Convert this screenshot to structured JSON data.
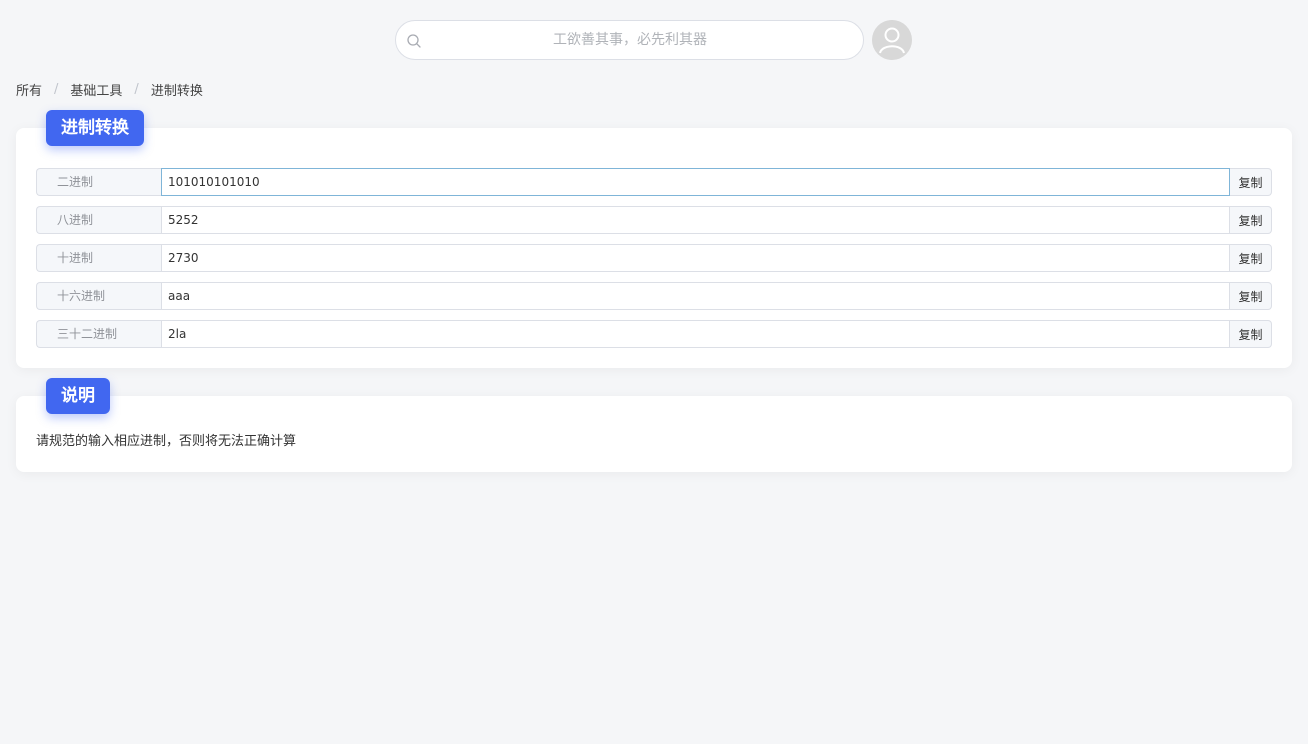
{
  "header": {
    "search_placeholder": "工欲善其事，必先利其器"
  },
  "breadcrumb": {
    "items": [
      "所有",
      "基础工具",
      "进制转换"
    ],
    "separator": "/"
  },
  "converter": {
    "title": "进制转换",
    "copy_label": "复制",
    "rows": [
      {
        "label": "二进制",
        "value": "101010101010"
      },
      {
        "label": "八进制",
        "value": "5252"
      },
      {
        "label": "十进制",
        "value": "2730"
      },
      {
        "label": "十六进制",
        "value": "aaa"
      },
      {
        "label": "三十二进制",
        "value": "2la"
      }
    ]
  },
  "note": {
    "title": "说明",
    "text": "请规范的输入相应进制，否则将无法正确计算"
  },
  "colors": {
    "accent": "#4167f0",
    "background": "#f5f6f8"
  },
  "icons": {
    "search": "search-icon",
    "avatar": "user-avatar-icon"
  }
}
